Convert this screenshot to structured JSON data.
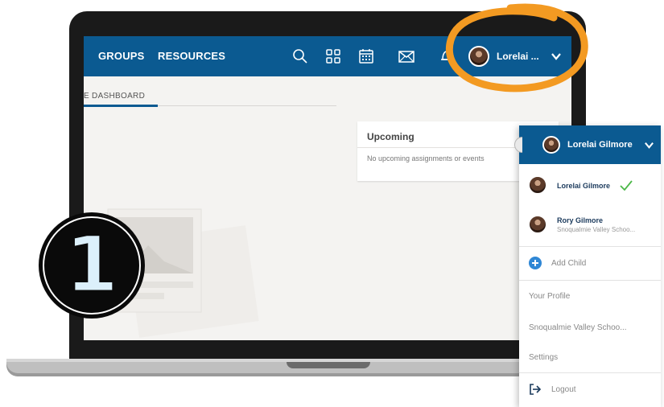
{
  "nav": {
    "links": [
      "GROUPS",
      "RESOURCES"
    ],
    "icons": [
      "search-icon",
      "apps-grid-icon",
      "calendar-icon",
      "mail-icon",
      "notification-icon"
    ],
    "user_name": "Lorelai ...",
    "chevron_icon": "chevron-down-icon"
  },
  "main": {
    "tab_label": "E DASHBOARD",
    "upcoming": {
      "title": "Upcoming",
      "empty_text": "No upcoming assignments or events"
    }
  },
  "overlay": {
    "step_number": "1",
    "highlight_color": "#f39a22"
  },
  "dropdown": {
    "header_name": "Lorelai Gilmore",
    "accounts": [
      {
        "name": "Lorelai Gilmore",
        "sub": "",
        "selected": true
      },
      {
        "name": "Rory Gilmore",
        "sub": "Snoqualmie Valley Schoo...",
        "selected": false
      }
    ],
    "add_child": "Add Child",
    "menu": [
      "Your Profile",
      "Snoqualmie Valley Schoo...",
      "Settings"
    ],
    "logout": "Logout"
  },
  "colors": {
    "brand_blue": "#0b5a91",
    "check_green": "#4cb848",
    "add_blue": "#2f87d5"
  }
}
